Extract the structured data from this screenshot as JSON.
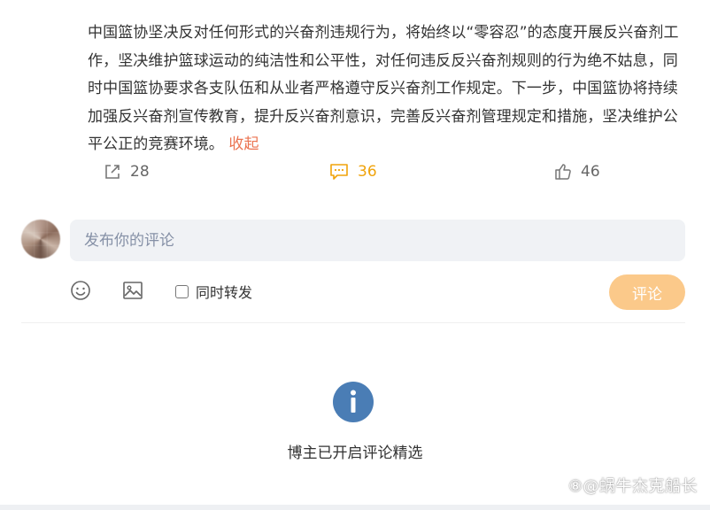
{
  "post": {
    "text": "中国篮协坚决反对任何形式的兴奋剂违规行为，将始终以“零容忍”的态度开展反兴奋剂工作，坚决维护篮球运动的纯洁性和公平性，对任何违反反兴奋剂规则的行为绝不姑息，同时中国篮协要求各支队伍和从业者严格遵守反兴奋剂工作规定。下一步，中国篮协将持续加强反兴奋剂宣传教育，提升反兴奋剂意识，完善反兴奋剂管理规定和措施，坚决维护公平公正的竞赛环境。",
    "collapse_label": "收起"
  },
  "actions": {
    "share_count": "28",
    "comment_count": "36",
    "like_count": "46"
  },
  "composer": {
    "placeholder": "发布你的评论",
    "repost_label": "同时转发",
    "submit_label": "评论"
  },
  "notice": {
    "text": "博主已开启评论精选"
  },
  "watermark": {
    "text": "⑧@蜗牛杰克船长"
  },
  "colors": {
    "accent": "#eb7350",
    "comment_active": "#f0a30a",
    "submit_bg": "#fbc98a",
    "info_icon": "#4a7db5"
  }
}
